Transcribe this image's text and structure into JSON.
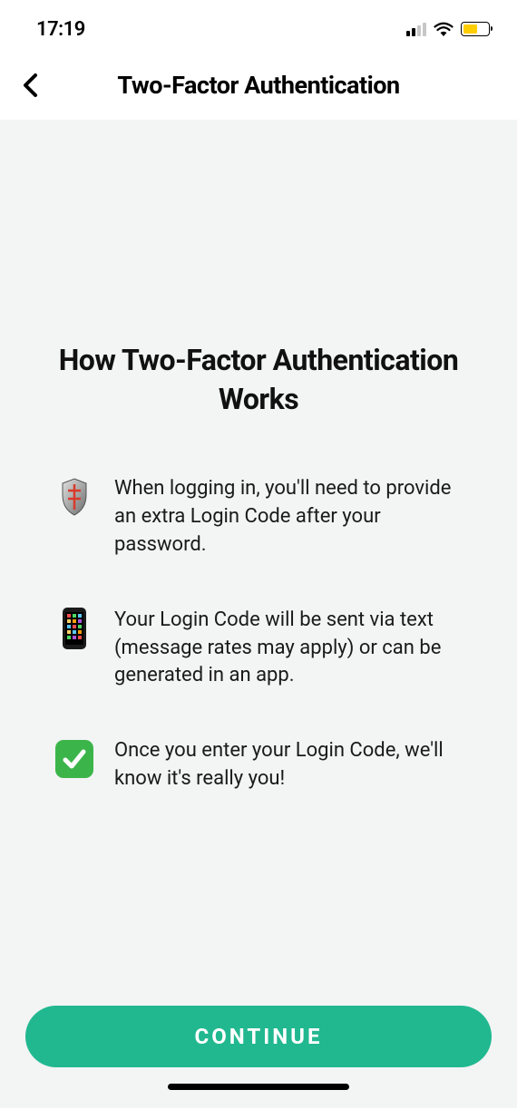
{
  "status_bar": {
    "time": "17:19"
  },
  "header": {
    "title": "Two-Factor Authentication"
  },
  "content": {
    "heading": "How Two-Factor Authentication Works",
    "steps": [
      {
        "icon_name": "shield",
        "text": "When logging in, you'll need to provide an extra Login Code after your password."
      },
      {
        "icon_name": "phone",
        "text": "Your Login Code will be sent via text (message rates may apply) or can be generated in an app."
      },
      {
        "icon_name": "checkmark",
        "text": "Once you enter your Login Code, we'll know it's really you!"
      }
    ]
  },
  "footer": {
    "continue_label": "CONTINUE"
  }
}
